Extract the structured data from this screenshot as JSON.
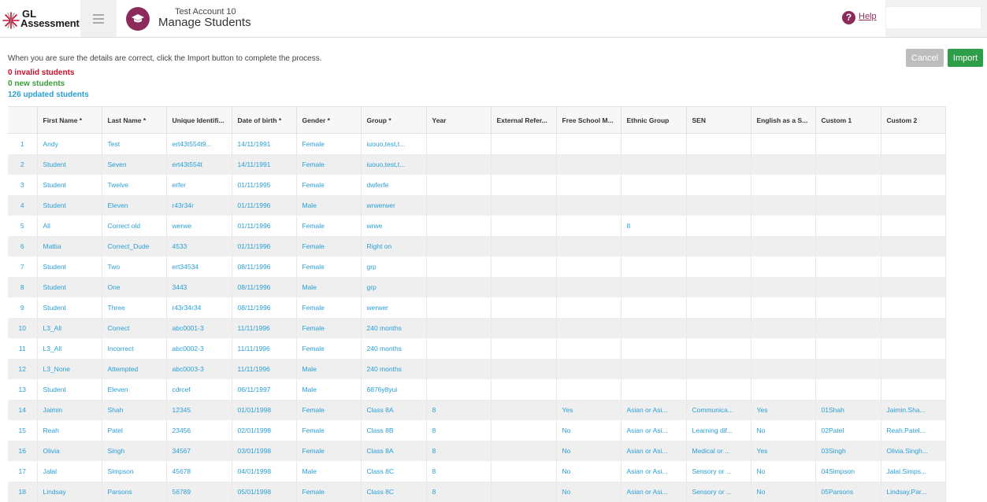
{
  "header": {
    "logo_line1": "GL",
    "logo_line2": "Assessment",
    "account": "Test Account 10",
    "title": "Manage Students",
    "help": "Help"
  },
  "instructions": "When you are sure the details are correct, click the Import button to complete the process.",
  "stats": {
    "invalid": "0 invalid students",
    "new": "0 new students",
    "updated": "126 updated students"
  },
  "buttons": {
    "cancel": "Cancel",
    "import": "Import"
  },
  "colors": {
    "brand": "#8c2a5c",
    "import": "#2e9e4b",
    "link": "#2a9fd6",
    "invalid": "#c8102e",
    "new": "#3a9d3a"
  },
  "columns": [
    "",
    "First Name *",
    "Last Name *",
    "Unique Identifi...",
    "Date of birth *",
    "Gender *",
    "Group *",
    "Year",
    "External Refer...",
    "Free School M...",
    "Ethnic Group",
    "SEN",
    "English as a S...",
    "Custom 1",
    "Custom 2"
  ],
  "rows": [
    [
      "1",
      "Andy",
      "Test",
      "ert43t554t9...",
      "14/11/1991",
      "Female",
      "iuouo,test,t...",
      "",
      "",
      "",
      "",
      "",
      "",
      "",
      ""
    ],
    [
      "2",
      "Student",
      "Seven",
      "ert43t554t",
      "14/11/1991",
      "Female",
      "iuouo,test,t...",
      "",
      "",
      "",
      "",
      "",
      "",
      "",
      ""
    ],
    [
      "3",
      "Student",
      "Twelve",
      "erfer",
      "01/11/1995",
      "Female",
      "dwferfe",
      "",
      "",
      "",
      "",
      "",
      "",
      "",
      ""
    ],
    [
      "4",
      "Student",
      "Eleven",
      "r43r34r",
      "01/11/1996",
      "Male",
      "wrwerwer",
      "",
      "",
      "",
      "",
      "",
      "",
      "",
      ""
    ],
    [
      "5",
      "All",
      "Correct old",
      "werwe",
      "01/11/1996",
      "Female",
      "wrwe",
      "",
      "",
      "",
      "8",
      "",
      "",
      "",
      ""
    ],
    [
      "6",
      "Mattia",
      "Correct_Dude",
      "4533",
      "01/11/1996",
      "Female",
      "Right on",
      "",
      "",
      "",
      "",
      "",
      "",
      "",
      ""
    ],
    [
      "7",
      "Student",
      "Two",
      "ert34534",
      "08/11/1996",
      "Female",
      "grp",
      "",
      "",
      "",
      "",
      "",
      "",
      "",
      ""
    ],
    [
      "8",
      "Student",
      "One",
      "3443",
      "08/11/1996",
      "Male",
      "grp",
      "",
      "",
      "",
      "",
      "",
      "",
      "",
      ""
    ],
    [
      "9",
      "Student",
      "Three",
      "r43r34r34",
      "08/11/1996",
      "Female",
      "werwer",
      "",
      "",
      "",
      "",
      "",
      "",
      "",
      ""
    ],
    [
      "10",
      "L3_All",
      "Correct",
      "abc0001-3",
      "11/11/1996",
      "Female",
      "240 months",
      "",
      "",
      "",
      "",
      "",
      "",
      "",
      ""
    ],
    [
      "11",
      "L3_All",
      "Incorrect",
      "abc0002-3",
      "11/11/1996",
      "Female",
      "240 months",
      "",
      "",
      "",
      "",
      "",
      "",
      "",
      ""
    ],
    [
      "12",
      "L3_None",
      "Attempted",
      "abc0003-3",
      "11/11/1996",
      "Male",
      "240 months",
      "",
      "",
      "",
      "",
      "",
      "",
      "",
      ""
    ],
    [
      "13",
      "Student",
      "Eleven",
      "cdrcef",
      "06/11/1997",
      "Male",
      "6876y8yui",
      "",
      "",
      "",
      "",
      "",
      "",
      "",
      ""
    ],
    [
      "14",
      "Jaimin",
      "Shah",
      "12345",
      "01/01/1998",
      "Female",
      "Class 8A",
      "8",
      "",
      "Yes",
      "Asian or Asi...",
      "Communica...",
      "Yes",
      "01Shah",
      "Jaimin.Sha..."
    ],
    [
      "15",
      "Reah",
      "Patel",
      "23456",
      "02/01/1998",
      "Female",
      "Class 8B",
      "8",
      "",
      "No",
      "Asian or Asi...",
      "Learning dif...",
      "No",
      "02Patel",
      "Reah.Patel..."
    ],
    [
      "16",
      "Olivia",
      "Singh",
      "34567",
      "03/01/1998",
      "Female",
      "Class 8A",
      "8",
      "",
      "No",
      "Asian or Asi...",
      "Medical or ...",
      "Yes",
      "03Singh",
      "Olivia.Singh..."
    ],
    [
      "17",
      "Jalal",
      "Simpson",
      "45678",
      "04/01/1998",
      "Male",
      "Class 8C",
      "8",
      "",
      "No",
      "Asian or Asi...",
      "Sensory or ...",
      "No",
      "04Simpson",
      "Jalal.Simps..."
    ],
    [
      "18",
      "Lindsay",
      "Parsons",
      "56789",
      "05/01/1998",
      "Female",
      "Class 8C",
      "8",
      "",
      "No",
      "Asian or Asi...",
      "Sensory or ...",
      "No",
      "05Parsons",
      "Lindsay.Par..."
    ]
  ]
}
